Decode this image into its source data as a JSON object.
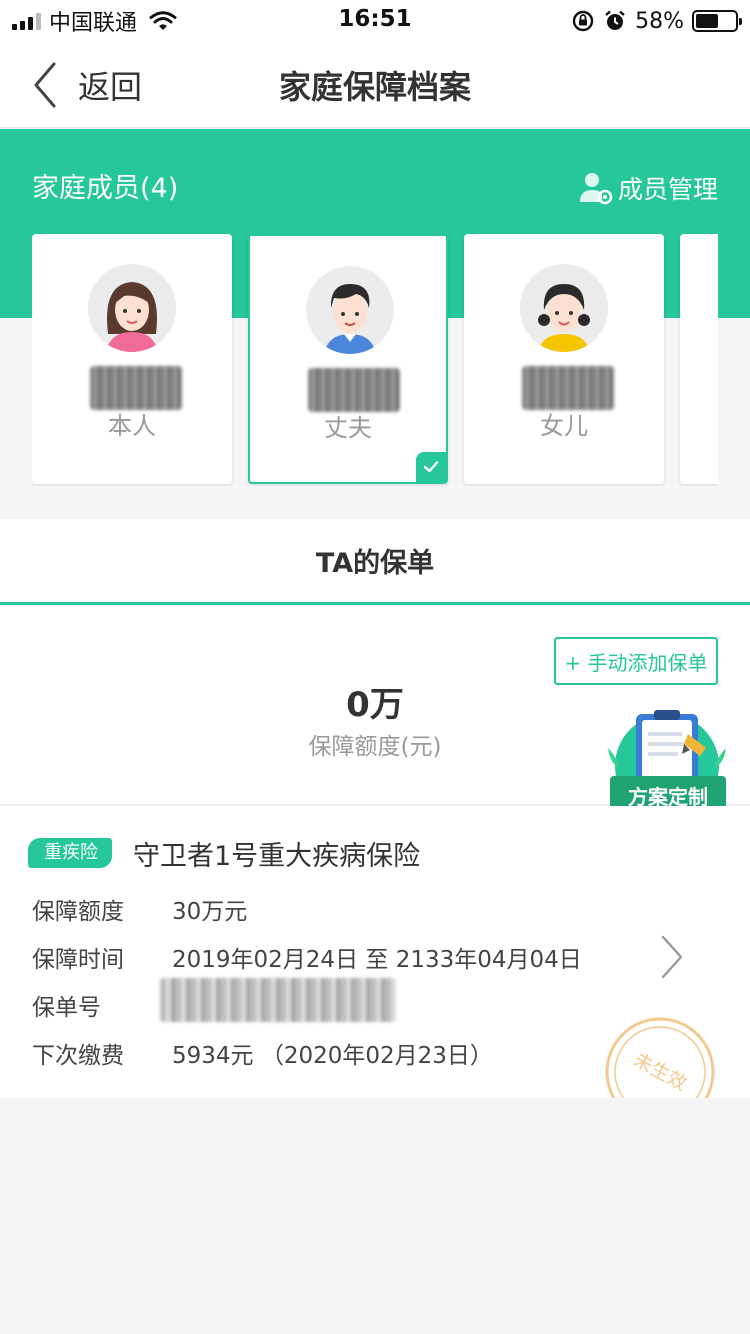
{
  "status_bar": {
    "carrier": "中国联通",
    "time": "16:51",
    "battery_percent": "58%",
    "battery_level": 0.58,
    "icons": [
      "signal-icon",
      "wifi-icon",
      "rotation-lock-icon",
      "alarm-icon",
      "battery-icon"
    ]
  },
  "nav": {
    "back_label": "返回",
    "title": "家庭保障档案"
  },
  "members": {
    "title": "家庭成员(4)",
    "manage_label": "成员管理",
    "items": [
      {
        "label": "本人",
        "avatar": "female-avatar-icon",
        "selected": false
      },
      {
        "label": "丈夫",
        "avatar": "male-avatar-icon",
        "selected": true
      },
      {
        "label": "女儿",
        "avatar": "girl-avatar-icon",
        "selected": false
      }
    ]
  },
  "policies": {
    "section_title": "TA的保单",
    "add_label": "+ 手动添加保单",
    "total_amount": "0万",
    "total_label": "保障额度(元)",
    "plan_label": "方案定制",
    "list": [
      {
        "type_badge": "重疾险",
        "name": "守卫者1号重大疾病保险",
        "rows": [
          {
            "label": "保障额度",
            "value": "30万元"
          },
          {
            "label": "保障时间",
            "value": "2019年02月24日 至 2133年04月04日"
          },
          {
            "label": "保单号",
            "value": ""
          },
          {
            "label": "下次缴费",
            "value": "5934元 （2020年02月23日）"
          }
        ],
        "stamp": "未生效"
      }
    ]
  },
  "colors": {
    "accent": "#26c79a",
    "accent_dark": "#1fa372",
    "stamp": "#f2c98e",
    "text": "#333333",
    "muted": "#999999"
  }
}
